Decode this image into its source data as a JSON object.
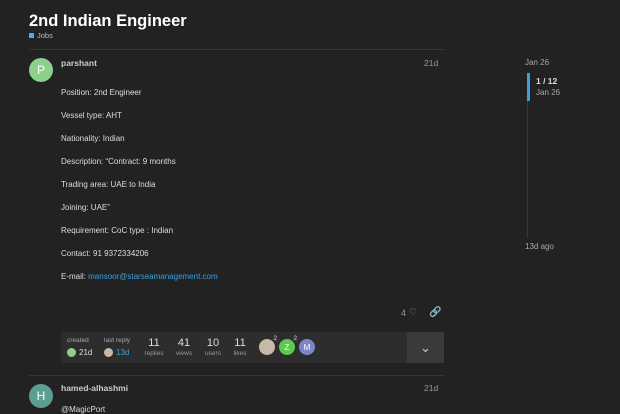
{
  "topic": {
    "title": "2nd Indian Engineer",
    "category": "Jobs",
    "category_color": "#3ab0ff"
  },
  "post1": {
    "avatar_letter": "P",
    "username": "parshant",
    "age": "21d",
    "lines": [
      "Position: 2nd Engineer",
      "Vessel type: AHT",
      "Nationality: Indian",
      "Description: “Contract: 9 months",
      "Trading area: UAE to India",
      "Joining: UAE”",
      "Requirement: CoC type : Indian",
      "Contact: 91 9372334206"
    ],
    "email_label": "E-mail: ",
    "email": "mansoor@starseamanagement.com",
    "likes": "4"
  },
  "topic_map": {
    "created_label": "created",
    "created_value": "21d",
    "last_reply_label": "last reply",
    "last_reply_value": "13d",
    "stats": [
      {
        "num": "11",
        "label": "replies"
      },
      {
        "num": "41",
        "label": "views"
      },
      {
        "num": "10",
        "label": "users"
      },
      {
        "num": "11",
        "label": "likes"
      }
    ],
    "participants": [
      {
        "letter": "",
        "count": "2",
        "color": "#c8b8a8"
      },
      {
        "letter": "Z",
        "count": "2",
        "color": "#5cc94f"
      },
      {
        "letter": "M",
        "count": "",
        "color": "#7d86c9"
      }
    ]
  },
  "post2": {
    "avatar_letter": "H",
    "username": "hamed-alhashmi",
    "age": "21d",
    "body": "@MagicPort"
  },
  "timeline": {
    "start_date": "Jan 26",
    "position": "1 / 12",
    "current_date": "Jan 26",
    "end_age": "13d ago"
  }
}
